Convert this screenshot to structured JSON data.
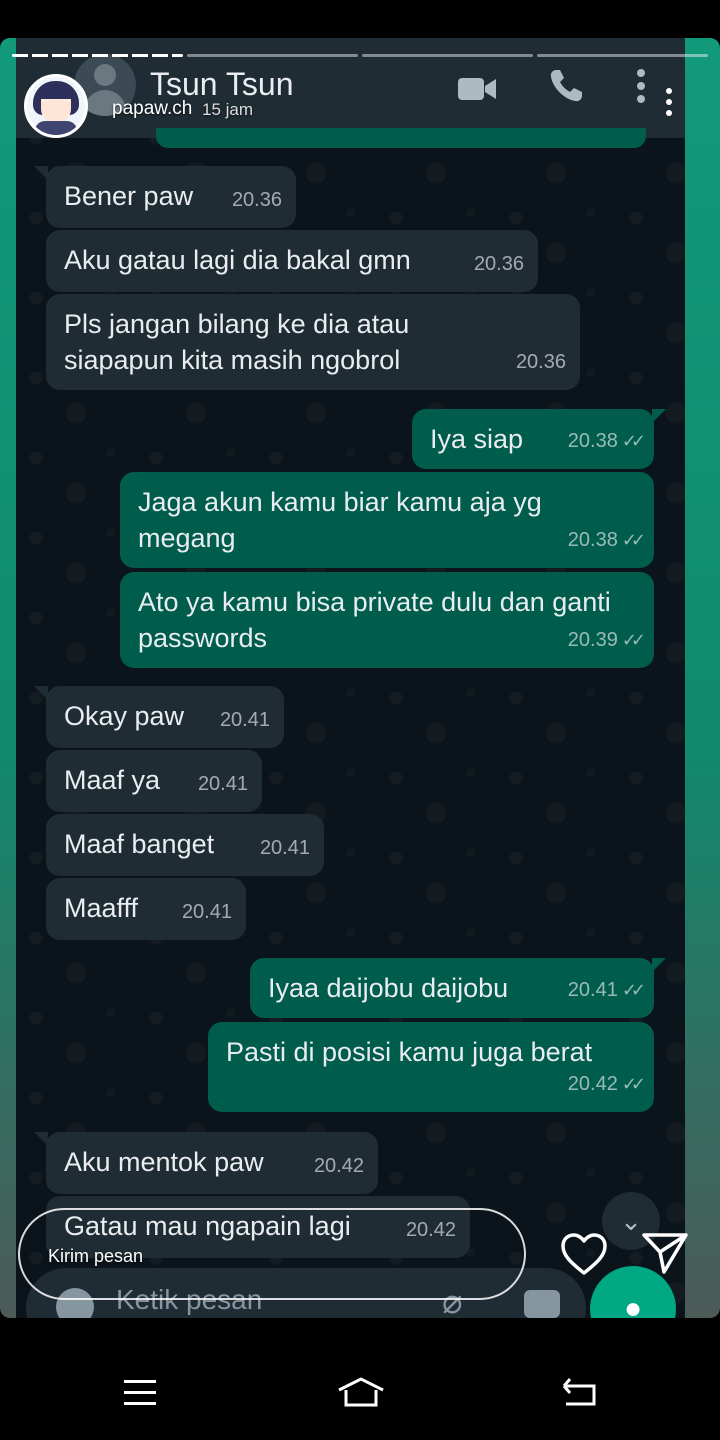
{
  "story": {
    "username": "papaw.ch",
    "time_ago": "15 jam",
    "reply_placeholder": "Kirim pesan"
  },
  "chat": {
    "contact_name": "Tsun Tsun",
    "composer_placeholder": "Ketik pesan"
  },
  "messages": [
    {
      "dir": "in",
      "text": "Bener paw",
      "time": "20.36"
    },
    {
      "dir": "in",
      "text": "Aku gatau lagi dia bakal gmn",
      "time": "20.36"
    },
    {
      "dir": "in",
      "text": "Pls jangan bilang ke dia atau siapapun kita masih ngobrol",
      "time": "20.36"
    },
    {
      "dir": "out",
      "text": "Iya siap",
      "time": "20.38"
    },
    {
      "dir": "out",
      "text": "Jaga akun kamu biar kamu aja yg megang",
      "time": "20.38"
    },
    {
      "dir": "out",
      "text": "Ato ya kamu bisa private dulu dan ganti passwords",
      "time": "20.39"
    },
    {
      "dir": "in",
      "text": "Okay paw",
      "time": "20.41"
    },
    {
      "dir": "in",
      "text": "Maaf ya",
      "time": "20.41"
    },
    {
      "dir": "in",
      "text": "Maaf banget",
      "time": "20.41"
    },
    {
      "dir": "in",
      "text": "Maafff",
      "time": "20.41"
    },
    {
      "dir": "out",
      "text": "Iyaa daijobu daijobu",
      "time": "20.41"
    },
    {
      "dir": "out",
      "text": "Pasti di posisi kamu juga berat",
      "time": "20.42"
    },
    {
      "dir": "in",
      "text": "Aku mentok paw",
      "time": "20.42"
    },
    {
      "dir": "in",
      "text": "Gatau mau ngapain lagi",
      "time": "20.42"
    }
  ],
  "colors": {
    "incoming_bubble": "#202c33",
    "outgoing_bubble": "#005c4b",
    "chat_background": "#0b141a",
    "story_background": "#12997a",
    "mic_button": "#00a884"
  },
  "icons": {
    "video": "video-call-icon",
    "call": "phone-icon",
    "menu": "more-vertical-icon",
    "like": "heart-icon",
    "share": "send-icon",
    "scroll": "chevron-double-down-icon"
  }
}
